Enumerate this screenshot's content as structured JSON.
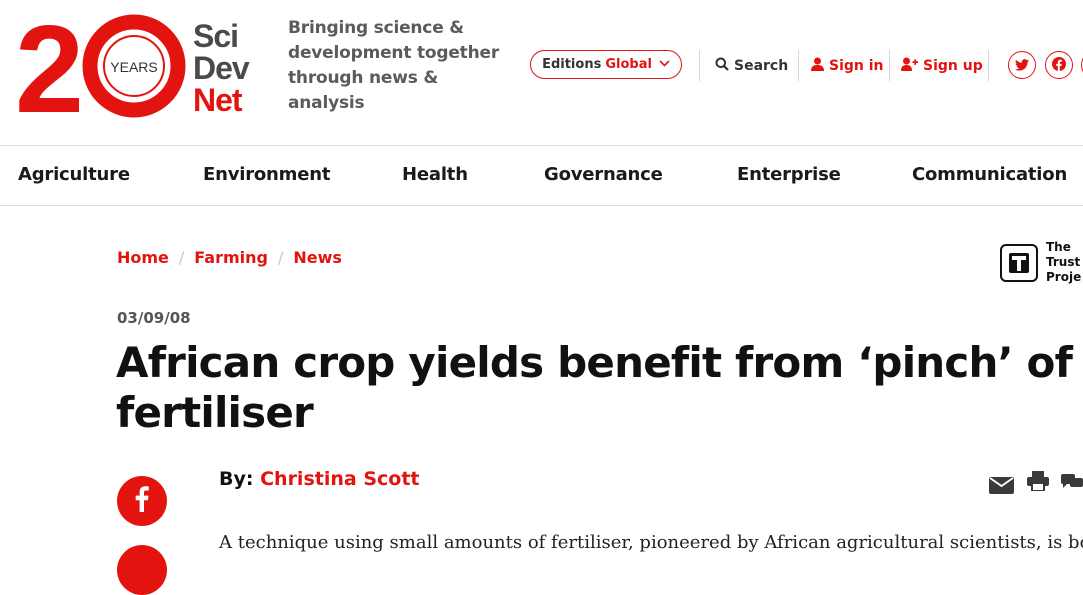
{
  "header": {
    "logo": {
      "years_number": "20",
      "years_label": "YEARS",
      "brand_lines": [
        "Sci",
        "Dev",
        "Net"
      ]
    },
    "tagline": "Bringing science & development together through news & analysis",
    "editions": {
      "label": "Editions",
      "value": "Global"
    },
    "search_label": "Search",
    "signin_label": "Sign in",
    "signup_label": "Sign up",
    "social_icons": [
      "twitter-icon",
      "facebook-icon"
    ]
  },
  "nav": {
    "items": [
      "Agriculture",
      "Environment",
      "Health",
      "Governance",
      "Enterprise",
      "Communication"
    ]
  },
  "breadcrumb": [
    "Home",
    "Farming",
    "News"
  ],
  "trust_project": {
    "line1": "The",
    "line2": "Trust",
    "line3": "Proje"
  },
  "article": {
    "date": "03/09/08",
    "title": "African crop yields benefit from ‘pinch’ of fertiliser",
    "byline_prefix": "By:",
    "author": "Christina Scott",
    "lead": "A technique using small amounts of fertiliser, pioneered by African agricultural scientists, is boost"
  },
  "colors": {
    "accent": "#e3140f",
    "text": "#1a1a1a",
    "muted": "#5b5b5b"
  }
}
